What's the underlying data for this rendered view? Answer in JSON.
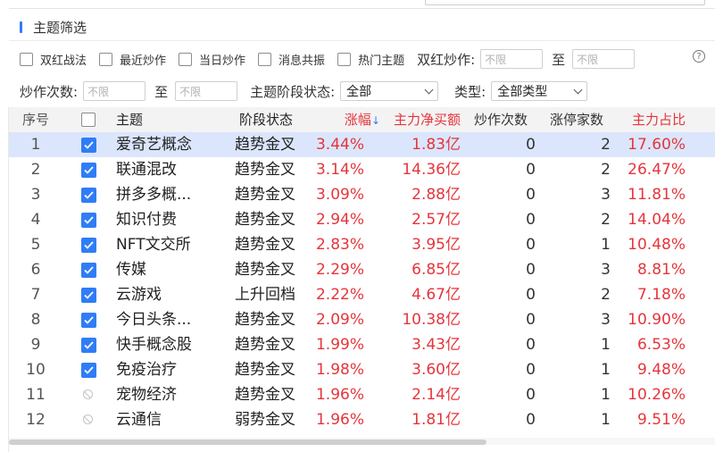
{
  "section": {
    "title": "主题筛选"
  },
  "filters": {
    "checkboxes": [
      {
        "label": "双红战法"
      },
      {
        "label": "最近炒作"
      },
      {
        "label": "当日炒作"
      },
      {
        "label": "消息共振"
      },
      {
        "label": "热门主题"
      }
    ],
    "shuanghong": {
      "label": "双红炒作:",
      "from_placeholder": "不限",
      "to_label": "至",
      "to_placeholder": "不限"
    },
    "count": {
      "label": "炒作次数:",
      "from_placeholder": "不限",
      "to_label": "至",
      "to_placeholder": "不限"
    },
    "stage": {
      "label": "主题阶段状态:",
      "value": "全部"
    },
    "type": {
      "label": "类型:",
      "value": "全部类型"
    }
  },
  "table": {
    "headers": {
      "index": "序号",
      "theme": "主题",
      "stage": "阶段状态",
      "change": "涨幅",
      "net_buy": "主力净买额",
      "hype_count": "炒作次数",
      "limit_up": "涨停家数",
      "ratio": "主力占比"
    },
    "sort_arrow": "↓",
    "rows": [
      {
        "index": "1",
        "checked": true,
        "theme": "爱奇艺概念",
        "stage": "趋势金叉",
        "change": "3.44%",
        "net_buy": "1.83亿",
        "hype_count": "0",
        "limit_up": "2",
        "ratio": "17.60%"
      },
      {
        "index": "2",
        "checked": true,
        "theme": "联通混改",
        "stage": "趋势金叉",
        "change": "3.14%",
        "net_buy": "14.36亿",
        "hype_count": "0",
        "limit_up": "2",
        "ratio": "26.47%"
      },
      {
        "index": "3",
        "checked": true,
        "theme": "拼多多概...",
        "stage": "趋势金叉",
        "change": "3.09%",
        "net_buy": "2.88亿",
        "hype_count": "0",
        "limit_up": "3",
        "ratio": "11.81%"
      },
      {
        "index": "4",
        "checked": true,
        "theme": "知识付费",
        "stage": "趋势金叉",
        "change": "2.94%",
        "net_buy": "2.57亿",
        "hype_count": "0",
        "limit_up": "2",
        "ratio": "14.04%"
      },
      {
        "index": "5",
        "checked": true,
        "theme": "NFT文交所",
        "stage": "趋势金叉",
        "change": "2.83%",
        "net_buy": "3.95亿",
        "hype_count": "0",
        "limit_up": "1",
        "ratio": "10.48%"
      },
      {
        "index": "6",
        "checked": true,
        "theme": "传媒",
        "stage": "趋势金叉",
        "change": "2.29%",
        "net_buy": "6.85亿",
        "hype_count": "0",
        "limit_up": "3",
        "ratio": "8.81%"
      },
      {
        "index": "7",
        "checked": true,
        "theme": "云游戏",
        "stage": "上升回档",
        "change": "2.22%",
        "net_buy": "4.67亿",
        "hype_count": "0",
        "limit_up": "2",
        "ratio": "7.18%"
      },
      {
        "index": "8",
        "checked": true,
        "theme": "今日头条...",
        "stage": "趋势金叉",
        "change": "2.09%",
        "net_buy": "10.38亿",
        "hype_count": "0",
        "limit_up": "3",
        "ratio": "10.90%"
      },
      {
        "index": "9",
        "checked": true,
        "theme": "快手概念股",
        "stage": "趋势金叉",
        "change": "1.99%",
        "net_buy": "3.43亿",
        "hype_count": "0",
        "limit_up": "1",
        "ratio": "6.53%"
      },
      {
        "index": "10",
        "checked": true,
        "theme": "免疫治疗",
        "stage": "趋势金叉",
        "change": "1.98%",
        "net_buy": "3.60亿",
        "hype_count": "0",
        "limit_up": "1",
        "ratio": "9.48%"
      },
      {
        "index": "11",
        "checked": false,
        "theme": "宠物经济",
        "stage": "趋势金叉",
        "change": "1.96%",
        "net_buy": "2.14亿",
        "hype_count": "0",
        "limit_up": "1",
        "ratio": "10.26%"
      },
      {
        "index": "12",
        "checked": false,
        "theme": "云通信",
        "stage": "弱势金叉",
        "change": "1.96%",
        "net_buy": "1.81亿",
        "hype_count": "0",
        "limit_up": "1",
        "ratio": "9.51%"
      }
    ]
  },
  "colors": {
    "accent": "#2f7df6",
    "up": "#e5353b",
    "selected_row": "#dbe6fc"
  }
}
